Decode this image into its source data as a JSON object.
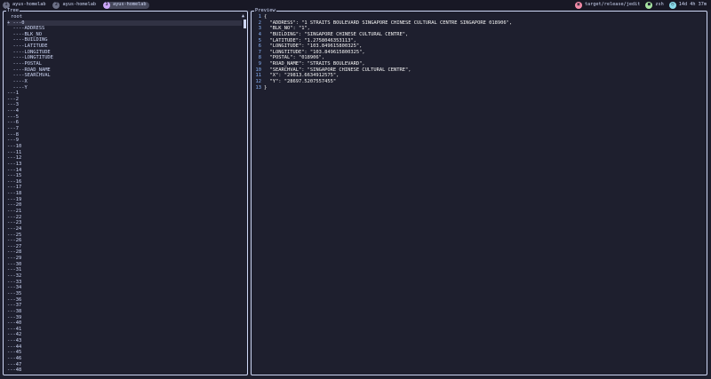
{
  "tmux": {
    "tabs": [
      {
        "num": "1",
        "name": "ayus-homelab",
        "active": false
      },
      {
        "num": "2",
        "name": "ayus-homelab",
        "active": false
      },
      {
        "num": "3",
        "name": "ayus-homelab",
        "active": true
      }
    ],
    "status": [
      {
        "icon": "folder-icon",
        "glyph": "▣",
        "color": "#f38ba8",
        "text": "target/release/jedit"
      },
      {
        "icon": "terminal-icon",
        "glyph": "■",
        "color": "#a6e3a1",
        "text": "zsh"
      },
      {
        "icon": "clock-icon",
        "glyph": "◷",
        "color": "#89dceb",
        "text": "14d 4h 37m"
      }
    ]
  },
  "tree": {
    "title": "Tree",
    "root": "root",
    "rows": [
      "+ ---0",
      "  ----ADDRESS",
      "  ----BLK_NO",
      "  ----BUILDING",
      "  ----LATITUDE",
      "  ----LONGITUDE",
      "  ----LONGTITUDE",
      "  ----POSTAL",
      "  ----ROAD_NAME",
      "  ----SEARCHVAL",
      "  ----X",
      "  ----Y",
      "---1",
      "---2",
      "---3",
      "---4",
      "---5",
      "---6",
      "---7",
      "---8",
      "---9",
      "---10",
      "---11",
      "---12",
      "---13",
      "---14",
      "---15",
      "---16",
      "---17",
      "---18",
      "---19",
      "---20",
      "---21",
      "---22",
      "---23",
      "---24",
      "---25",
      "---26",
      "---27",
      "---28",
      "---29",
      "---30",
      "---31",
      "---32",
      "---33",
      "---34",
      "---35",
      "---36",
      "---37",
      "---38",
      "---39",
      "---40",
      "---41",
      "---42",
      "---43",
      "---44",
      "---45",
      "---46",
      "---47",
      "---48"
    ],
    "selected_index": 0,
    "scroll_arrow": "▲"
  },
  "preview": {
    "title": "Preview",
    "lines": [
      "{",
      "  \"ADDRESS\": \"1 STRAITS BOULEVARD SINGAPORE CHINESE CULTURAL CENTRE SINGAPORE 018906\",",
      "  \"BLK_NO\": \"1\",",
      "  \"BUILDING\": \"SINGAPORE CHINESE CULTURAL CENTRE\",",
      "  \"LATITUDE\": \"1.2758046353113\",",
      "  \"LONGITUDE\": \"103.849615800325\",",
      "  \"LONGTITUDE\": \"103.849615800325\",",
      "  \"POSTAL\": \"018906\",",
      "  \"ROAD_NAME\": \"STRAITS BOULEVARD\",",
      "  \"SEARCHVAL\": \"SINGAPORE CHINESE CULTURAL CENTRE\",",
      "  \"X\": \"29813.6634912575\",",
      "  \"Y\": \"28697.5207557455\"",
      "}"
    ]
  }
}
